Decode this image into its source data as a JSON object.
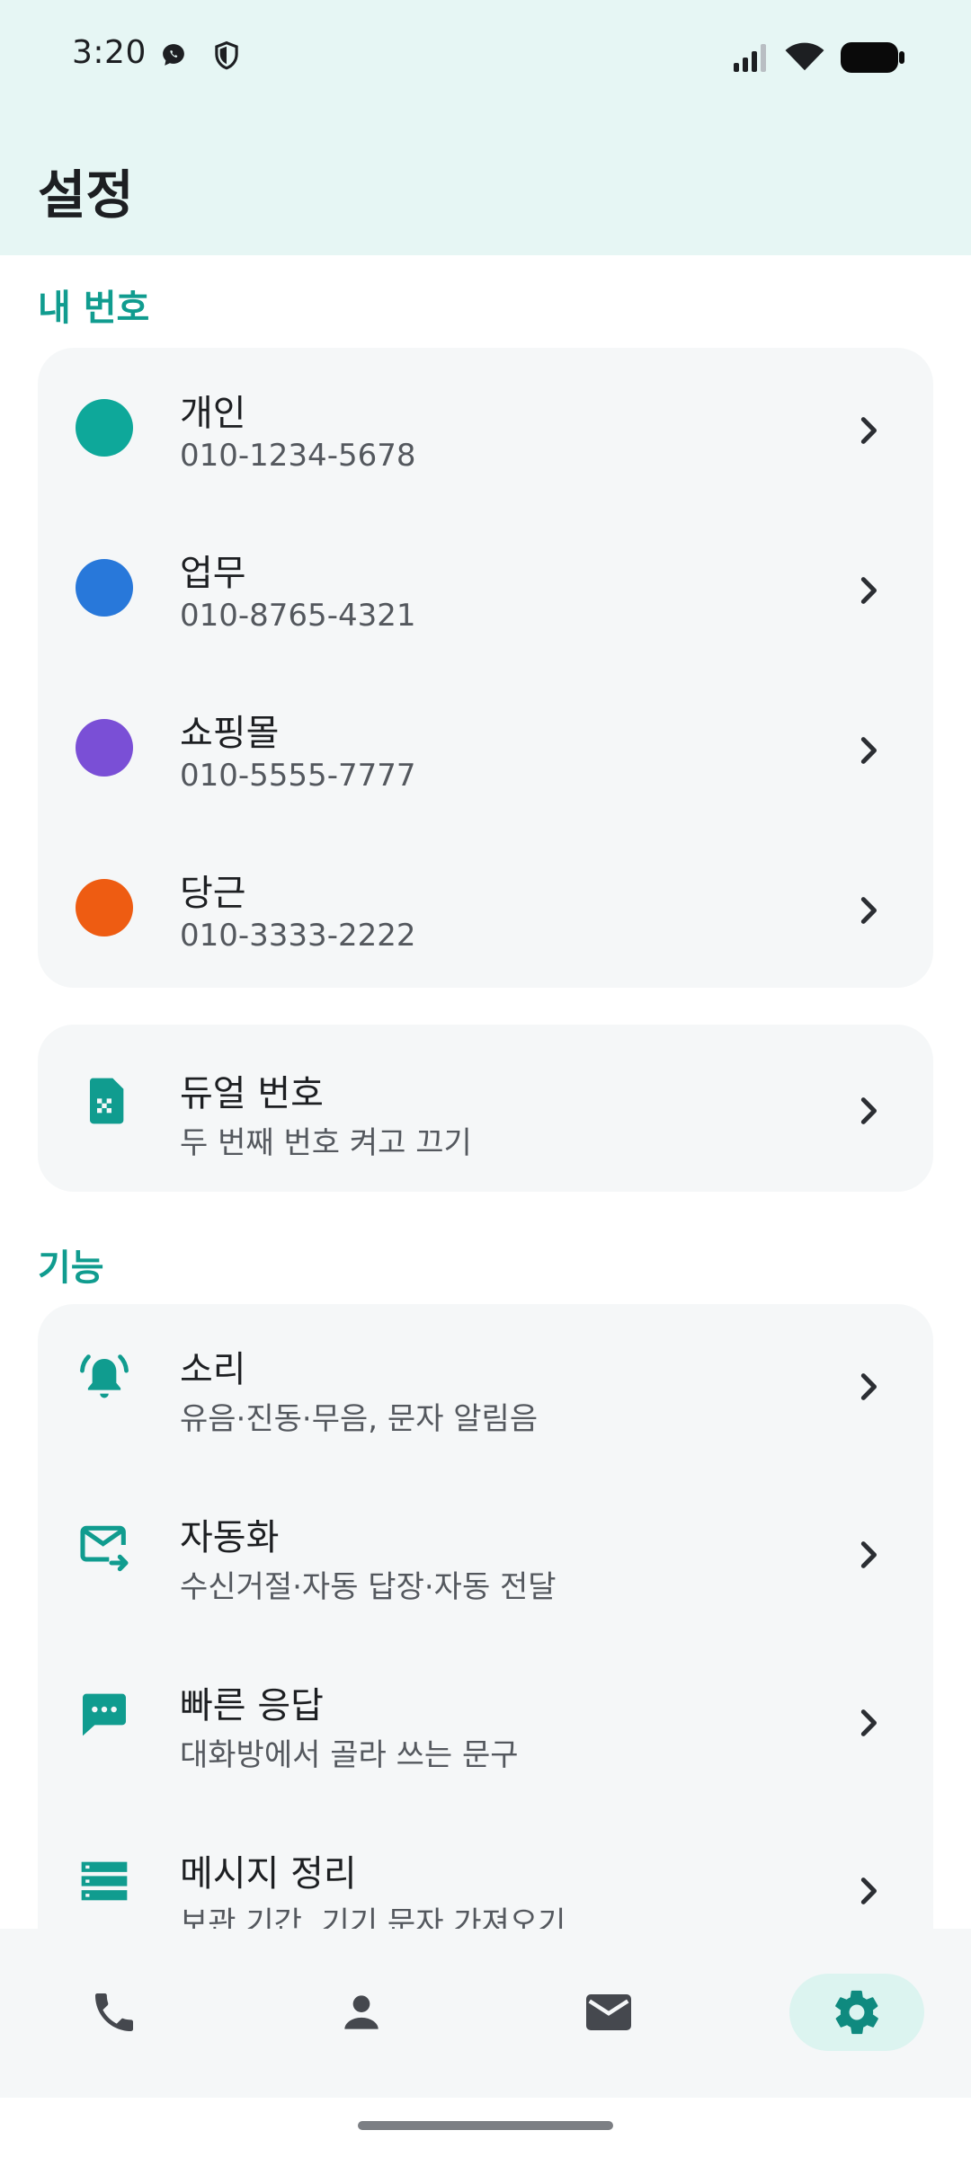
{
  "status": {
    "time": "3:20"
  },
  "header": {
    "title": "설정"
  },
  "sections": {
    "my_numbers": "내 번호",
    "features": "기능"
  },
  "numbers": [
    {
      "name": "개인",
      "phone": "010-1234-5678",
      "color": "#0ea89a"
    },
    {
      "name": "업무",
      "phone": "010-8765-4321",
      "color": "#2878da"
    },
    {
      "name": "쇼핑몰",
      "phone": "010-5555-7777",
      "color": "#7a4fd6"
    },
    {
      "name": "당근",
      "phone": "010-3333-2222",
      "color": "#ee5c12"
    }
  ],
  "dual": {
    "title": "듀얼 번호",
    "subtitle": "두 번째 번호 켜고 끄기",
    "icon": "sim-card-icon"
  },
  "features": [
    {
      "title": "소리",
      "subtitle": "유음·진동·무음, 문자 알림음",
      "icon": "bell-ring-icon"
    },
    {
      "title": "자동화",
      "subtitle": "수신거절·자동 답장·자동 전달",
      "icon": "mail-forward-icon"
    },
    {
      "title": "빠른 응답",
      "subtitle": "대화방에서 골라 쓰는 문구",
      "icon": "chat-dots-icon"
    },
    {
      "title": "메시지 정리",
      "subtitle": "보관 기간, 기기 문자 가져오기",
      "icon": "storage-list-icon"
    }
  ],
  "nav": [
    {
      "id": "phone",
      "icon": "phone-icon",
      "active": false
    },
    {
      "id": "contacts",
      "icon": "person-icon",
      "active": false
    },
    {
      "id": "messages",
      "icon": "mail-icon",
      "active": false
    },
    {
      "id": "settings",
      "icon": "gear-icon",
      "active": true
    }
  ],
  "colors": {
    "accent": "#109c8f",
    "header_bg": "#e6f6f4",
    "card_bg": "#f5f7f8"
  }
}
